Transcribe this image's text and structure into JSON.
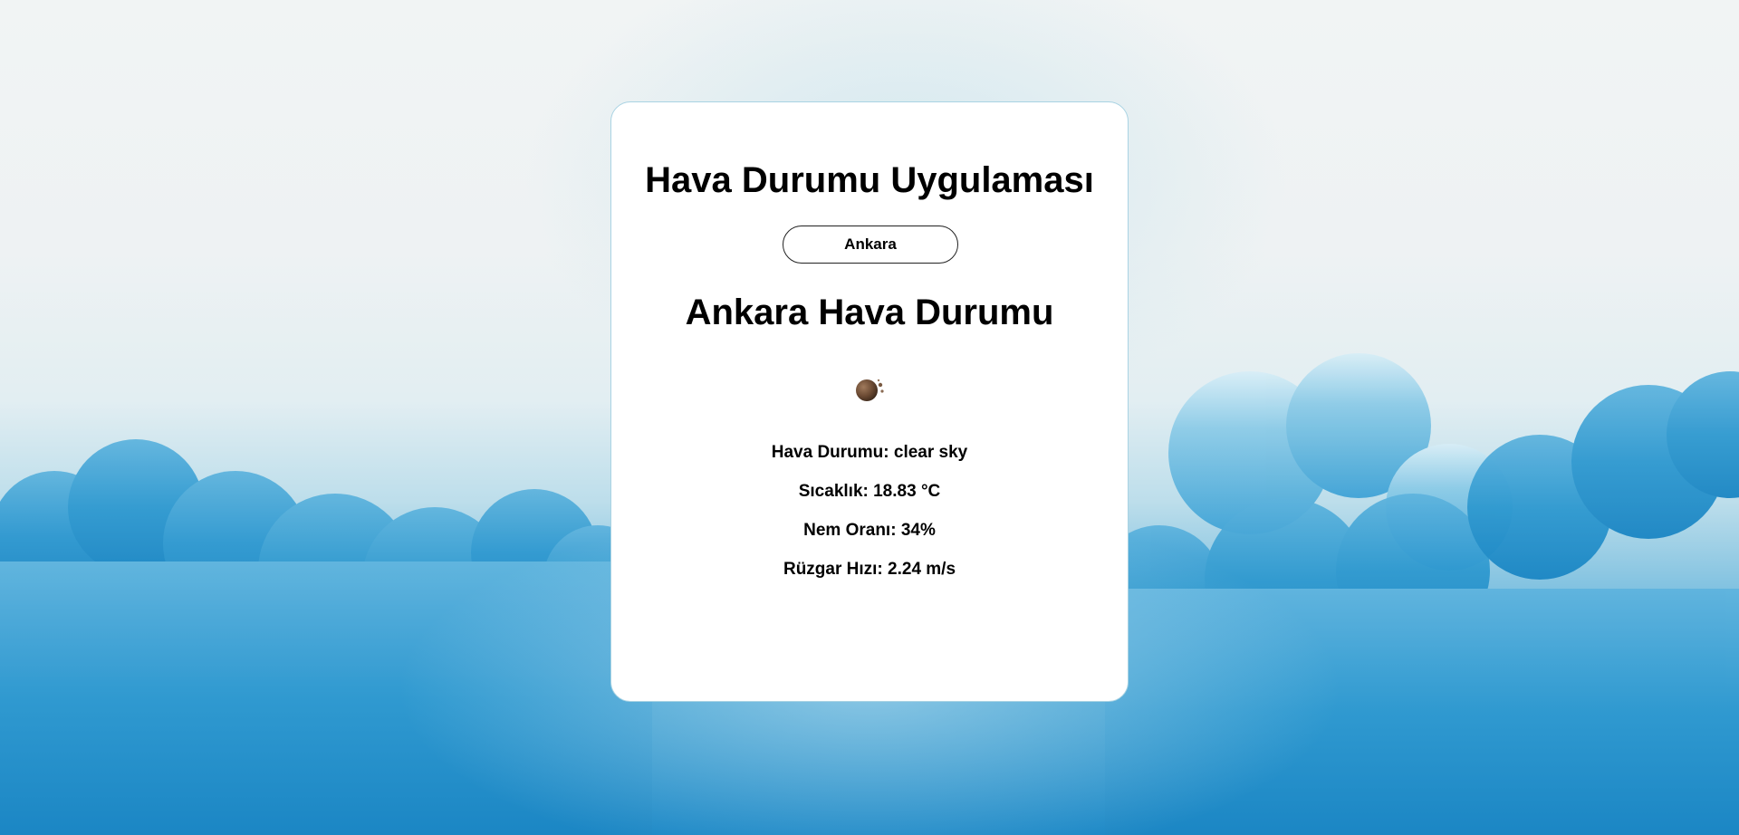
{
  "app": {
    "title": "Hava Durumu Uygulaması"
  },
  "search": {
    "city_button_label": "Ankara"
  },
  "weather": {
    "heading": "Ankara Hava Durumu",
    "icon": "moon-clear-night-icon",
    "description": "Hava Durumu: clear sky",
    "temperature": "Sıcaklık: 18.83 °C",
    "humidity": "Nem Oranı: 34%",
    "wind": "Rüzgar Hızı: 2.24 m/s"
  },
  "colors": {
    "card_border": "#a9d3e3",
    "sky_bottom": "#1a87c6"
  }
}
